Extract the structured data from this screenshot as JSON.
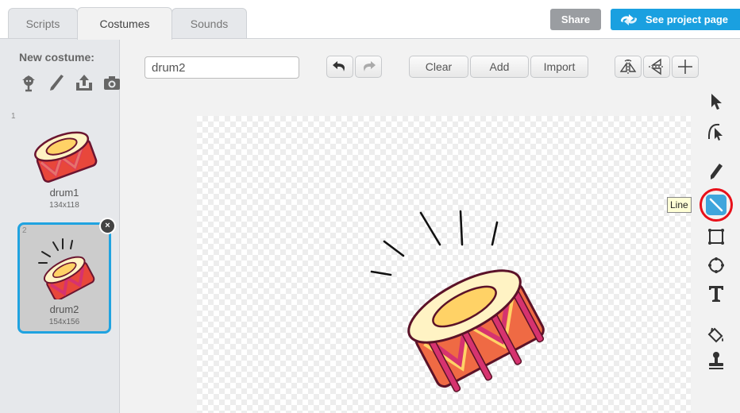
{
  "tabs": [
    {
      "label": "Scripts",
      "active": false
    },
    {
      "label": "Costumes",
      "active": true
    },
    {
      "label": "Sounds",
      "active": false
    }
  ],
  "header": {
    "share_label": "Share",
    "see_project_label": "See project page"
  },
  "left_panel": {
    "new_costume_label": "New costume:",
    "new_costume_icons": [
      "costume-library-icon",
      "paint-brush-icon",
      "upload-icon",
      "camera-icon"
    ],
    "costumes": [
      {
        "number": "1",
        "name": "drum1",
        "size": "134x118",
        "selected": false
      },
      {
        "number": "2",
        "name": "drum2",
        "size": "154x156",
        "selected": true
      }
    ],
    "delete_label": "×"
  },
  "editor": {
    "costume_name_value": "drum2",
    "toolbar": {
      "clear_label": "Clear",
      "add_label": "Add",
      "import_label": "Import"
    },
    "tools": [
      "select",
      "reshape",
      "pencil",
      "line",
      "rectangle",
      "ellipse",
      "text",
      "fill",
      "stamp"
    ],
    "selected_tool": "line",
    "tooltip_text": "Line"
  },
  "colors": {
    "accent_blue": "#1aa0e0",
    "selected_border": "#20a3e0",
    "highlight_ring": "#e8101a",
    "drum_red": "#e8473b",
    "drum_band": "#d6336f",
    "drum_top": "#fff3c4",
    "drum_center": "#ffd266"
  }
}
